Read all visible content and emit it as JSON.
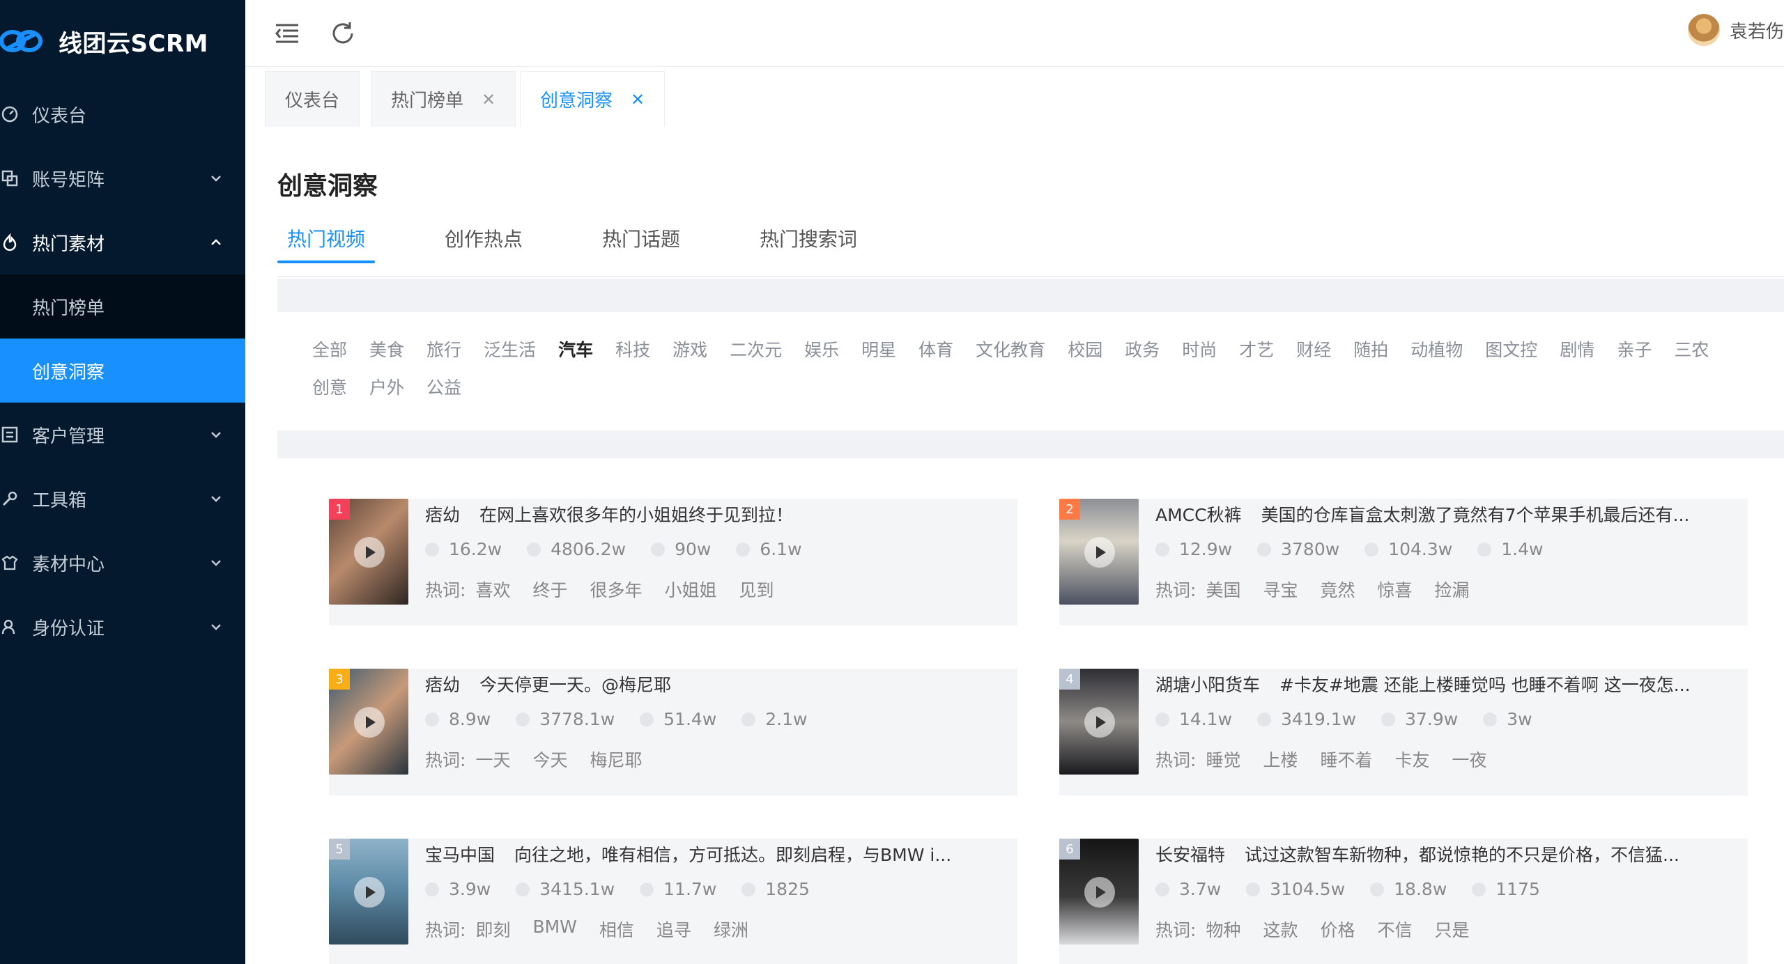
{
  "app": {
    "name": "线团云SCRM"
  },
  "sidebar": {
    "items": [
      {
        "label": "仪表台",
        "icon": "dashboard-icon",
        "expandable": false
      },
      {
        "label": "账号矩阵",
        "icon": "accounts-icon",
        "expandable": true
      },
      {
        "label": "热门素材",
        "icon": "hot-material-icon",
        "expandable": true,
        "expanded": true,
        "children": [
          {
            "label": "热门榜单"
          },
          {
            "label": "创意洞察",
            "active": true
          }
        ]
      },
      {
        "label": "客户管理",
        "icon": "customer-icon",
        "expandable": true
      },
      {
        "label": "工具箱",
        "icon": "toolbox-icon",
        "expandable": true
      },
      {
        "label": "素材中心",
        "icon": "material-center-icon",
        "expandable": true
      },
      {
        "label": "身份认证",
        "icon": "identity-icon",
        "expandable": true
      }
    ]
  },
  "header": {
    "user_name": "袁若伤"
  },
  "tabs": [
    {
      "label": "仪表台",
      "closable": false
    },
    {
      "label": "热门榜单",
      "closable": true
    },
    {
      "label": "创意洞察",
      "closable": true,
      "active": true
    }
  ],
  "page": {
    "title": "创意洞察",
    "subtabs": [
      "热门视频",
      "创作热点",
      "热门话题",
      "热门搜索词"
    ],
    "active_subtab": "热门视频",
    "keyword_prefix": "热词:"
  },
  "categories": [
    "全部",
    "美食",
    "旅行",
    "泛生活",
    "汽车",
    "科技",
    "游戏",
    "二次元",
    "娱乐",
    "明星",
    "体育",
    "文化教育",
    "校园",
    "政务",
    "时尚",
    "才艺",
    "财经",
    "随拍",
    "动植物",
    "图文控",
    "剧情",
    "亲子",
    "三农",
    "创意",
    "户外",
    "公益"
  ],
  "active_category": "汽车",
  "colors": {
    "accent": "#1890ff",
    "sidebar_bg": "#04192e",
    "rank_1": "#f5405a",
    "rank_2": "#ff7a45",
    "rank_3": "#faad14",
    "rank_other": "#b9c3cf"
  },
  "videos": [
    {
      "rank": "1",
      "author": "痞幼",
      "title": "在网上喜欢很多年的小姐姐终于见到拉！",
      "stats": [
        "16.2w",
        "4806.2w",
        "90w",
        "6.1w"
      ],
      "keywords": [
        "喜欢",
        "终于",
        "很多年",
        "小姐姐",
        "见到"
      ]
    },
    {
      "rank": "2",
      "author": "AMCC秋裤",
      "title": "美国的仓库盲盒太刺激了竟然有7个苹果手机最后还有...",
      "stats": [
        "12.9w",
        "3780w",
        "104.3w",
        "1.4w"
      ],
      "keywords": [
        "美国",
        "寻宝",
        "竟然",
        "惊喜",
        "捡漏"
      ]
    },
    {
      "rank": "3",
      "author": "痞幼",
      "title": "今天停更一天。@梅尼耶",
      "stats": [
        "8.9w",
        "3778.1w",
        "51.4w",
        "2.1w"
      ],
      "keywords": [
        "一天",
        "今天",
        "梅尼耶"
      ]
    },
    {
      "rank": "4",
      "author": "湖塘小阳货车",
      "title": "#卡友#地震 还能上楼睡觉吗 也睡不着啊 这一夜怎...",
      "stats": [
        "14.1w",
        "3419.1w",
        "37.9w",
        "3w"
      ],
      "keywords": [
        "睡觉",
        "上楼",
        "睡不着",
        "卡友",
        "一夜"
      ]
    },
    {
      "rank": "5",
      "author": "宝马中国",
      "title": "向往之地，唯有相信，方可抵达。即刻启程，与BMW i...",
      "stats": [
        "3.9w",
        "3415.1w",
        "11.7w",
        "1825"
      ],
      "keywords": [
        "即刻",
        "BMW",
        "相信",
        "追寻",
        "绿洲"
      ]
    },
    {
      "rank": "6",
      "author": "长安福特",
      "title": "试过这款智车新物种，都说惊艳的不只是价格，不信猛...",
      "stats": [
        "3.7w",
        "3104.5w",
        "18.8w",
        "1175"
      ],
      "keywords": [
        "物种",
        "这款",
        "价格",
        "不信",
        "只是"
      ]
    }
  ]
}
